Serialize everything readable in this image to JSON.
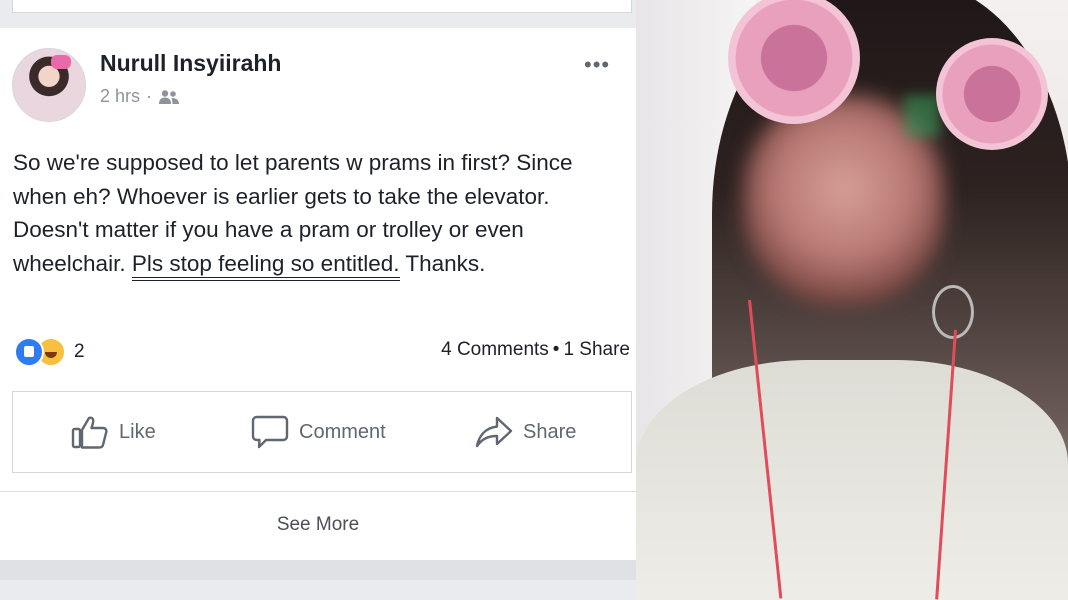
{
  "post": {
    "author": "Nurull Insyiirahh",
    "time": "2 hrs",
    "separator": "·",
    "text_intro": "So we're supposed to let parents w prams in first? Since when eh? Whoever is earlier gets to take the elevator. Doesn't matter if you have a pram or trolley or even wheelchair. ",
    "text_highlight": "Pls stop feeling so entitled.",
    "text_outro": " Thanks.",
    "more_label": "•••"
  },
  "reactions": {
    "count": "2",
    "comments": "4 Comments",
    "dot": "•",
    "shares": "1 Share"
  },
  "actions": {
    "like": "Like",
    "comment": "Comment",
    "share": "Share"
  },
  "footer": {
    "see_more": "See More"
  },
  "colors": {
    "like_blue": "#2e7bf5",
    "haha_yellow": "#f7c03e",
    "text_dark": "#1d2129",
    "muted": "#8d949e"
  }
}
